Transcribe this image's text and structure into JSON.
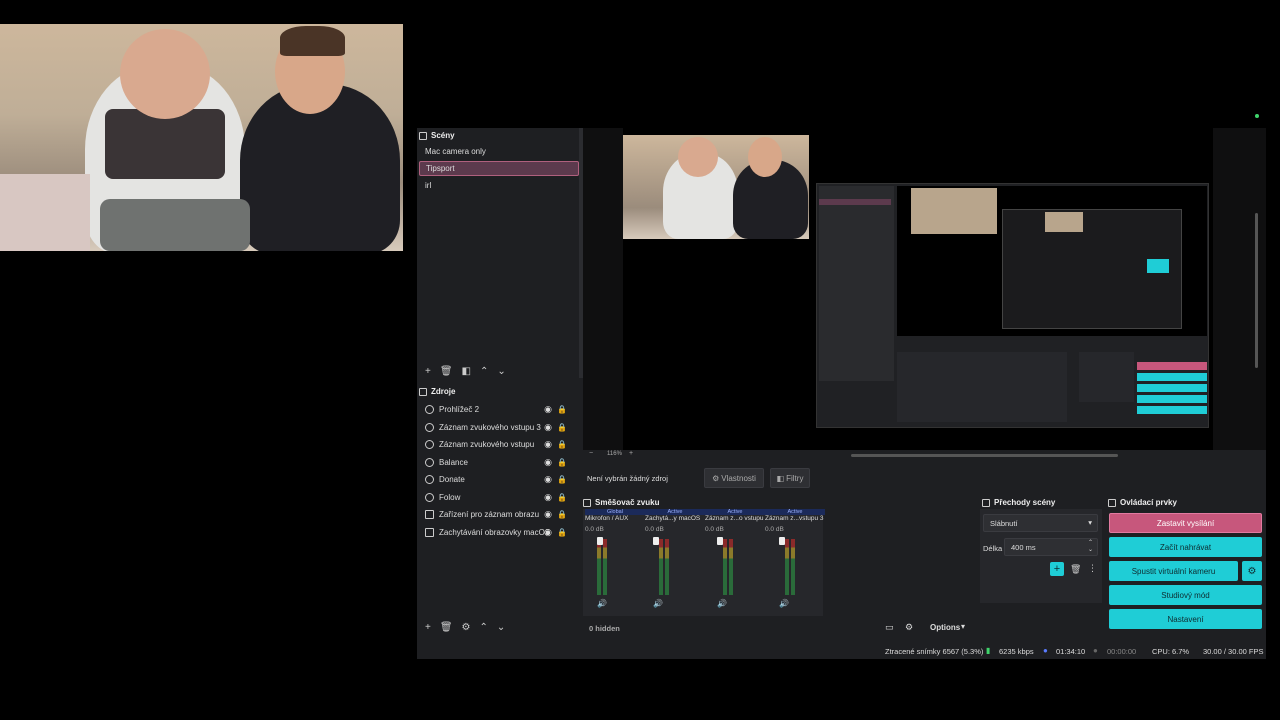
{
  "scenes": {
    "title": "Scény",
    "items": [
      "Mac camera only",
      "Tipsport",
      "irl"
    ],
    "selected_index": 1
  },
  "sources": {
    "title": "Zdroje",
    "items": [
      {
        "label": "Prohlížeč 2",
        "icon": "globe-icon"
      },
      {
        "label": "Záznam zvukového vstupu 3",
        "icon": "mic-icon"
      },
      {
        "label": "Záznam zvukového vstupu",
        "icon": "mic-icon"
      },
      {
        "label": "Balance",
        "icon": "globe-icon"
      },
      {
        "label": "Donate",
        "icon": "globe-icon"
      },
      {
        "label": "Folow",
        "icon": "globe-icon"
      },
      {
        "label": "Zařízení pro záznam obrazu",
        "icon": "camera-icon"
      },
      {
        "label": "Zachytávání obrazovky macOS",
        "icon": "monitor-icon"
      }
    ]
  },
  "preview": {
    "zoom": "116%",
    "no_source": "Není vybrán žádný zdroj",
    "properties": "Vlastnosti",
    "filters": "Filtry"
  },
  "mixer": {
    "title": "Směšovač zvuku",
    "hidden": "0 hidden",
    "options": "Options",
    "channels": [
      {
        "name": "Mikrofon / AUX",
        "tag": "Global",
        "db": "0.0 dB"
      },
      {
        "name": "Zachytá...y macOS",
        "tag": "Active",
        "db": "0.0 dB"
      },
      {
        "name": "Záznam z...o vstupu",
        "tag": "Active",
        "db": "0.0 dB"
      },
      {
        "name": "Záznam z...vstupu 3",
        "tag": "Active",
        "db": "0.0 dB"
      }
    ]
  },
  "transitions": {
    "title": "Přechody scény",
    "selected": "Slábnutí",
    "duration_label": "Délka",
    "duration_value": "400 ms"
  },
  "controls": {
    "title": "Ovládací prvky",
    "stop_stream": "Zastavit vysílání",
    "start_record": "Začít nahrávat",
    "virtual_cam": "Spustit virtuální kameru",
    "studio_mode": "Studiový mód",
    "settings": "Nastavení"
  },
  "statusbar": {
    "dropped": "Ztracené snímky 6567 (5.3%)",
    "bitrate": "6235 kbps",
    "stream_time": "01:34:10",
    "record_time": "00:00:00",
    "cpu": "CPU: 6.7%",
    "fps": "30.00 / 30.00 FPS"
  },
  "colors": {
    "accent": "#1fcdd6",
    "stop": "#c7577c",
    "selected_scene": "#5c3a4d"
  }
}
